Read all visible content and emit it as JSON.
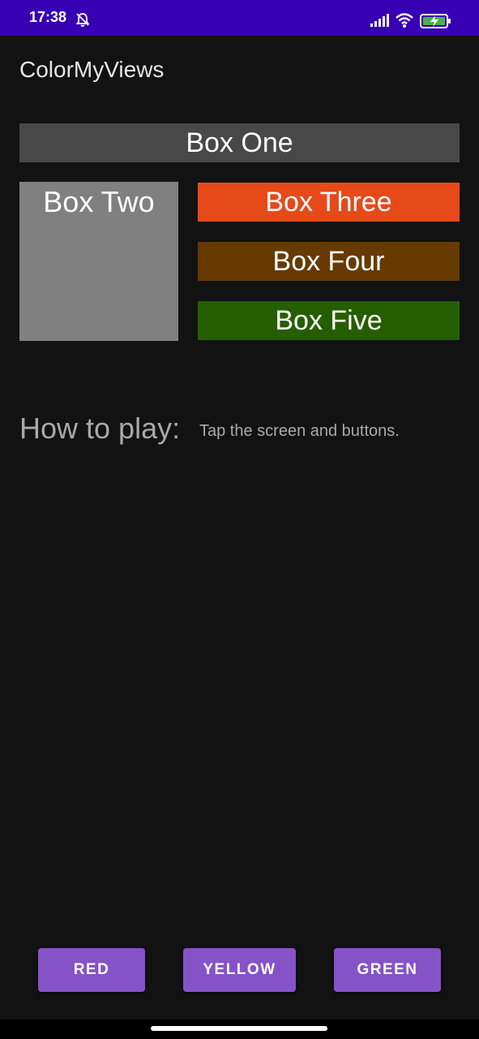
{
  "status_bar": {
    "time": "17:38",
    "icons": [
      "alarm-off-icon",
      "signal-icon",
      "wifi-icon",
      "battery-charging-icon"
    ],
    "background": "#3700b3"
  },
  "app_bar": {
    "title": "ColorMyViews"
  },
  "boxes": {
    "box_one": {
      "label": "Box One",
      "color": "#484848"
    },
    "box_two": {
      "label": "Box Two",
      "color": "#808080"
    },
    "box_three": {
      "label": "Box Three",
      "color": "#e64a19"
    },
    "box_four": {
      "label": "Box Four",
      "color": "#663a00"
    },
    "box_five": {
      "label": "Box Five",
      "color": "#255e00"
    }
  },
  "instructions": {
    "label": "How to play:",
    "text": "Tap the screen and buttons."
  },
  "buttons": {
    "red": "RED",
    "yellow": "YELLOW",
    "green": "GREEN",
    "color": "#8652c8"
  }
}
